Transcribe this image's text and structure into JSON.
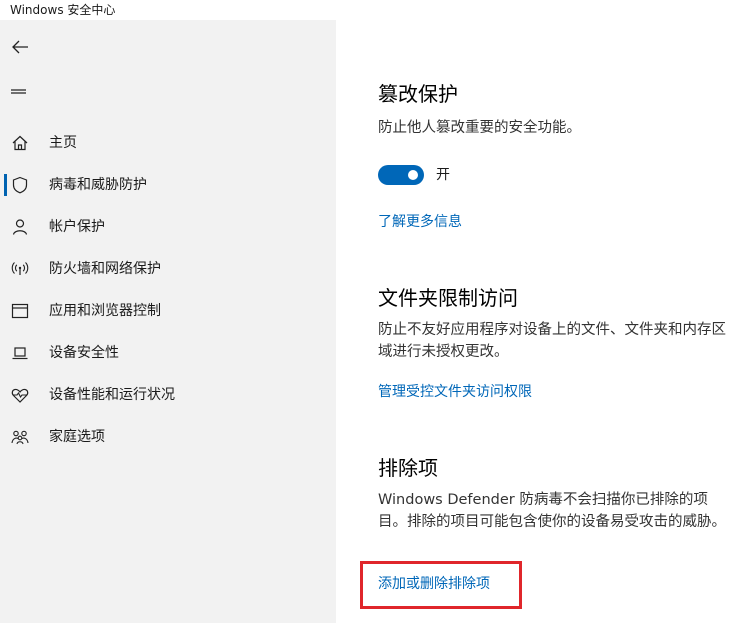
{
  "window": {
    "title": "Windows 安全中心"
  },
  "sidebar": {
    "items": [
      {
        "label": "主页",
        "icon": "home-icon",
        "active": false
      },
      {
        "label": "病毒和威胁防护",
        "icon": "shield-icon",
        "active": true
      },
      {
        "label": "帐户保护",
        "icon": "person-icon",
        "active": false
      },
      {
        "label": "防火墙和网络保护",
        "icon": "wifi-antenna-icon",
        "active": false
      },
      {
        "label": "应用和浏览器控制",
        "icon": "browser-window-icon",
        "active": false
      },
      {
        "label": "设备安全性",
        "icon": "laptop-icon",
        "active": false
      },
      {
        "label": "设备性能和运行状况",
        "icon": "heart-pulse-icon",
        "active": false
      },
      {
        "label": "家庭选项",
        "icon": "family-icon",
        "active": false
      }
    ]
  },
  "main": {
    "tamper": {
      "title": "篡改保护",
      "description": "防止他人篡改重要的安全功能。",
      "toggle_state": "开",
      "toggle_on": true,
      "link": "了解更多信息"
    },
    "folder_access": {
      "title": "文件夹限制访问",
      "description": "防止不友好应用程序对设备上的文件、文件夹和内存区域进行未授权更改。",
      "link": "管理受控文件夹访问权限"
    },
    "exclusions": {
      "title": "排除项",
      "description": "Windows Defender 防病毒不会扫描你已排除的项目。排除的项目可能包含使你的设备易受攻击的威胁。",
      "link": "添加或删除排除项"
    }
  },
  "colors": {
    "accent": "#0067b8",
    "sidebar_bg": "#f2f2f2",
    "highlight": "#e0262b"
  }
}
